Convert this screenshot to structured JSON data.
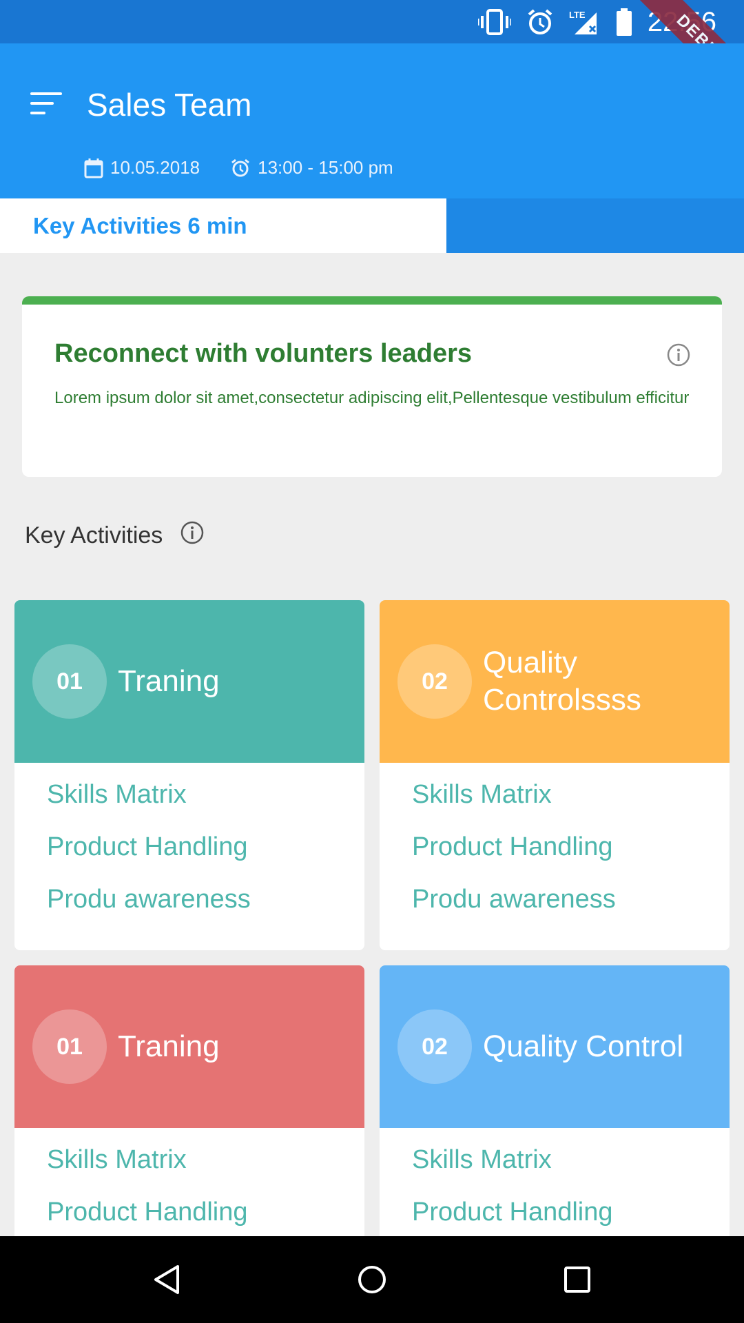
{
  "status_bar": {
    "time": "22:56",
    "debug_label": "DEBUG",
    "network": "LTE"
  },
  "app_bar": {
    "title": "Sales Team",
    "date": "10.05.2018",
    "time_range": "13:00 - 15:00 pm"
  },
  "tabs": {
    "active_label": "Key Activities 6 min"
  },
  "goal": {
    "title": "Reconnect with volunters leaders",
    "description": "Lorem ipsum dolor sit amet,consectetur adipiscing elit,Pellentesque vestibulum efficitur"
  },
  "section": {
    "title": "Key Activities"
  },
  "cards": [
    {
      "number": "01",
      "title": "Traning",
      "color": "#4db6ac",
      "items": [
        "Skills Matrix",
        "Product Handling",
        "Produ awareness"
      ]
    },
    {
      "number": "02",
      "title": "Quality Controlssss",
      "color": "#ffb74d",
      "items": [
        "Skills Matrix",
        "Product Handling",
        "Produ awareness"
      ]
    },
    {
      "number": "01",
      "title": "Traning",
      "color": "#e57373",
      "items": [
        "Skills Matrix",
        "Product Handling"
      ]
    },
    {
      "number": "02",
      "title": "Quality Control",
      "color": "#64b5f6",
      "items": [
        "Skills Matrix",
        "Product Handling"
      ]
    }
  ],
  "colors": {
    "status_bar": "#1976d2",
    "app_bar": "#2196f3",
    "goal_accent": "#4caf50",
    "item_text": "#4db6ac"
  }
}
